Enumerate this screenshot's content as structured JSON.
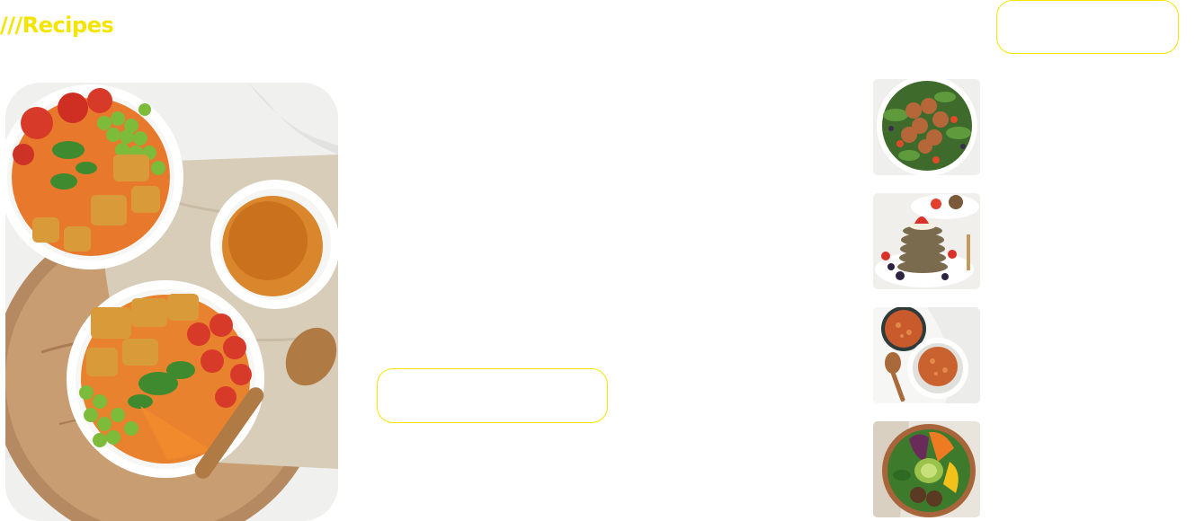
{
  "section": {
    "title": "///Recipes",
    "accent_color": "#f3e500"
  },
  "header": {
    "view_all_button_label": ""
  },
  "featured": {
    "image_icon": "buddha-bowl-photo",
    "title": "",
    "description": "",
    "button_label": ""
  },
  "recipe_list": [
    {
      "image_icon": "salad-with-fried-bites-photo",
      "title": ""
    },
    {
      "image_icon": "pancake-stack-with-berries-photo",
      "title": ""
    },
    {
      "image_icon": "red-lentil-dal-bowls-photo",
      "title": ""
    },
    {
      "image_icon": "veggie-bowl-with-falafel-photo",
      "title": ""
    }
  ]
}
